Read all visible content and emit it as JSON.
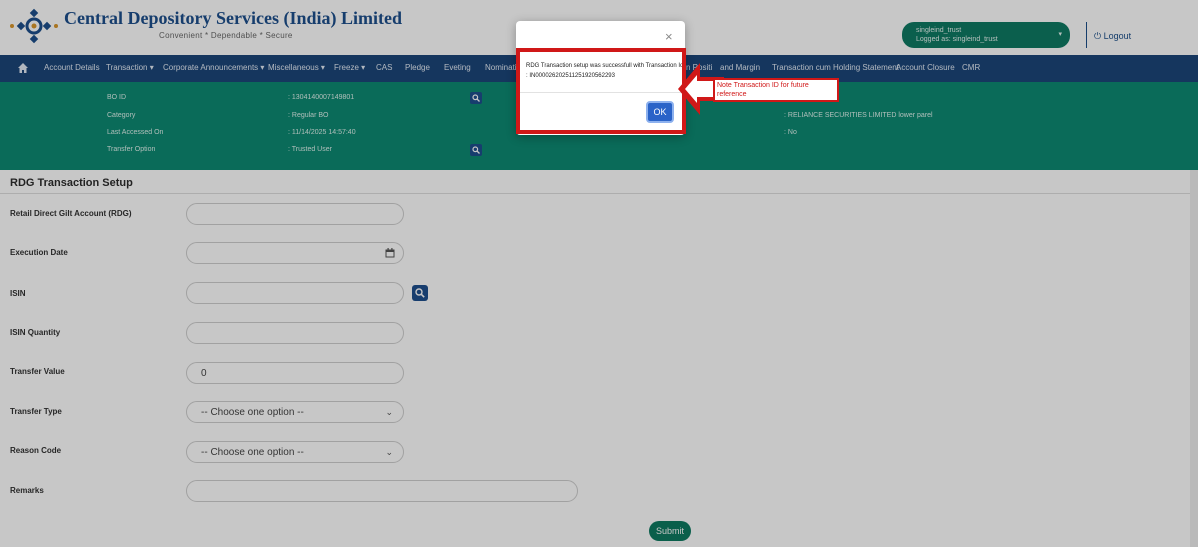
{
  "header": {
    "brand_title": "Central Depository Services (India) Limited",
    "brand_tagline": "Convenient  *  Dependable  *  Secure",
    "user_name": "singleind_trust",
    "logged_as": "Logged as: singleind_trust",
    "logout_label": "Logout"
  },
  "nav": {
    "items": [
      "Account Details",
      "Transaction",
      "Corporate Announcements",
      "Miscellaneous",
      "Freeze",
      "CAS",
      "Pledge",
      "Eveting",
      "Nominati",
      "n Positi",
      "and Margin",
      "Transaction cum Holding Statement",
      "Account Closure",
      "CMR"
    ]
  },
  "info": {
    "bo_id_label": "BO ID",
    "bo_id_value": ": 1304140007149801",
    "category_label": "Category",
    "category_value": ": Regular BO",
    "last_accessed_label": "Last Accessed On",
    "last_accessed_value": ": 11/14/2025 14:57:40",
    "transfer_option_label": "Transfer Option",
    "transfer_option_value": ": Trusted User",
    "dp_value": ": RELIANCE SECURITIES LIMITED lower parel",
    "no_value": ": No"
  },
  "form": {
    "section_title": "RDG Transaction Setup",
    "rdg_label": "Retail Direct Gilt Account (RDG)",
    "execution_date_label": "Execution Date",
    "isin_label": "ISIN",
    "isin_quantity_label": "ISIN Quantity",
    "transfer_value_label": "Transfer Value",
    "transfer_value": "0",
    "transfer_type_label": "Transfer Type",
    "transfer_type_value": "-- Choose one option --",
    "reason_code_label": "Reason Code",
    "reason_code_value": "-- Choose one option --",
    "remarks_label": "Remarks",
    "submit_label": "Submit"
  },
  "modal": {
    "close_glyph": "×",
    "message": "RDG Transaction setup was successfull with Transaction Id : IN000026202511251920562293",
    "ok_label": "OK"
  },
  "annotation": {
    "callout_text": "Note Transaction ID for future reference",
    "color": "#d01818"
  },
  "colors": {
    "navbar": "#1c4679",
    "info_bar": "#0e8a72",
    "accent_green": "#0e7a61",
    "ok_button": "#2a63c8"
  }
}
